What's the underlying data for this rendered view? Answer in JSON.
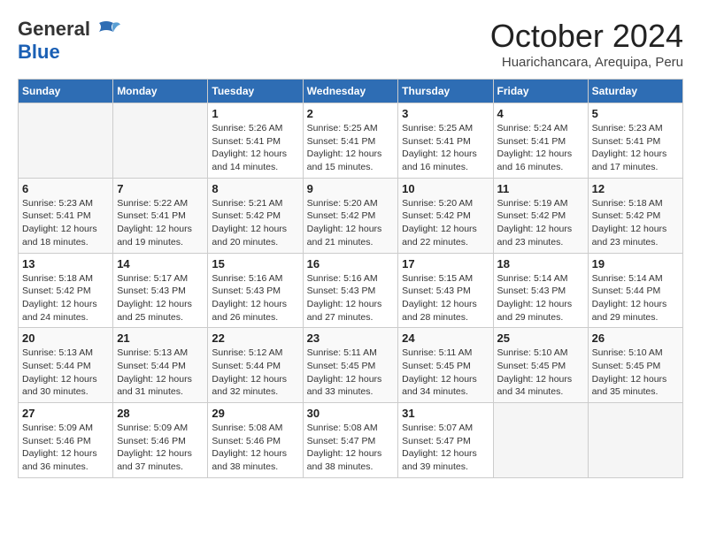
{
  "logo": {
    "general": "General",
    "blue": "Blue"
  },
  "title": {
    "month": "October 2024",
    "location": "Huarichancara, Arequipa, Peru"
  },
  "headers": [
    "Sunday",
    "Monday",
    "Tuesday",
    "Wednesday",
    "Thursday",
    "Friday",
    "Saturday"
  ],
  "weeks": [
    [
      {
        "day": "",
        "info": ""
      },
      {
        "day": "",
        "info": ""
      },
      {
        "day": "1",
        "info": "Sunrise: 5:26 AM\nSunset: 5:41 PM\nDaylight: 12 hours and 14 minutes."
      },
      {
        "day": "2",
        "info": "Sunrise: 5:25 AM\nSunset: 5:41 PM\nDaylight: 12 hours and 15 minutes."
      },
      {
        "day": "3",
        "info": "Sunrise: 5:25 AM\nSunset: 5:41 PM\nDaylight: 12 hours and 16 minutes."
      },
      {
        "day": "4",
        "info": "Sunrise: 5:24 AM\nSunset: 5:41 PM\nDaylight: 12 hours and 16 minutes."
      },
      {
        "day": "5",
        "info": "Sunrise: 5:23 AM\nSunset: 5:41 PM\nDaylight: 12 hours and 17 minutes."
      }
    ],
    [
      {
        "day": "6",
        "info": "Sunrise: 5:23 AM\nSunset: 5:41 PM\nDaylight: 12 hours and 18 minutes."
      },
      {
        "day": "7",
        "info": "Sunrise: 5:22 AM\nSunset: 5:41 PM\nDaylight: 12 hours and 19 minutes."
      },
      {
        "day": "8",
        "info": "Sunrise: 5:21 AM\nSunset: 5:42 PM\nDaylight: 12 hours and 20 minutes."
      },
      {
        "day": "9",
        "info": "Sunrise: 5:20 AM\nSunset: 5:42 PM\nDaylight: 12 hours and 21 minutes."
      },
      {
        "day": "10",
        "info": "Sunrise: 5:20 AM\nSunset: 5:42 PM\nDaylight: 12 hours and 22 minutes."
      },
      {
        "day": "11",
        "info": "Sunrise: 5:19 AM\nSunset: 5:42 PM\nDaylight: 12 hours and 23 minutes."
      },
      {
        "day": "12",
        "info": "Sunrise: 5:18 AM\nSunset: 5:42 PM\nDaylight: 12 hours and 23 minutes."
      }
    ],
    [
      {
        "day": "13",
        "info": "Sunrise: 5:18 AM\nSunset: 5:42 PM\nDaylight: 12 hours and 24 minutes."
      },
      {
        "day": "14",
        "info": "Sunrise: 5:17 AM\nSunset: 5:43 PM\nDaylight: 12 hours and 25 minutes."
      },
      {
        "day": "15",
        "info": "Sunrise: 5:16 AM\nSunset: 5:43 PM\nDaylight: 12 hours and 26 minutes."
      },
      {
        "day": "16",
        "info": "Sunrise: 5:16 AM\nSunset: 5:43 PM\nDaylight: 12 hours and 27 minutes."
      },
      {
        "day": "17",
        "info": "Sunrise: 5:15 AM\nSunset: 5:43 PM\nDaylight: 12 hours and 28 minutes."
      },
      {
        "day": "18",
        "info": "Sunrise: 5:14 AM\nSunset: 5:43 PM\nDaylight: 12 hours and 29 minutes."
      },
      {
        "day": "19",
        "info": "Sunrise: 5:14 AM\nSunset: 5:44 PM\nDaylight: 12 hours and 29 minutes."
      }
    ],
    [
      {
        "day": "20",
        "info": "Sunrise: 5:13 AM\nSunset: 5:44 PM\nDaylight: 12 hours and 30 minutes."
      },
      {
        "day": "21",
        "info": "Sunrise: 5:13 AM\nSunset: 5:44 PM\nDaylight: 12 hours and 31 minutes."
      },
      {
        "day": "22",
        "info": "Sunrise: 5:12 AM\nSunset: 5:44 PM\nDaylight: 12 hours and 32 minutes."
      },
      {
        "day": "23",
        "info": "Sunrise: 5:11 AM\nSunset: 5:45 PM\nDaylight: 12 hours and 33 minutes."
      },
      {
        "day": "24",
        "info": "Sunrise: 5:11 AM\nSunset: 5:45 PM\nDaylight: 12 hours and 34 minutes."
      },
      {
        "day": "25",
        "info": "Sunrise: 5:10 AM\nSunset: 5:45 PM\nDaylight: 12 hours and 34 minutes."
      },
      {
        "day": "26",
        "info": "Sunrise: 5:10 AM\nSunset: 5:45 PM\nDaylight: 12 hours and 35 minutes."
      }
    ],
    [
      {
        "day": "27",
        "info": "Sunrise: 5:09 AM\nSunset: 5:46 PM\nDaylight: 12 hours and 36 minutes."
      },
      {
        "day": "28",
        "info": "Sunrise: 5:09 AM\nSunset: 5:46 PM\nDaylight: 12 hours and 37 minutes."
      },
      {
        "day": "29",
        "info": "Sunrise: 5:08 AM\nSunset: 5:46 PM\nDaylight: 12 hours and 38 minutes."
      },
      {
        "day": "30",
        "info": "Sunrise: 5:08 AM\nSunset: 5:47 PM\nDaylight: 12 hours and 38 minutes."
      },
      {
        "day": "31",
        "info": "Sunrise: 5:07 AM\nSunset: 5:47 PM\nDaylight: 12 hours and 39 minutes."
      },
      {
        "day": "",
        "info": ""
      },
      {
        "day": "",
        "info": ""
      }
    ]
  ]
}
